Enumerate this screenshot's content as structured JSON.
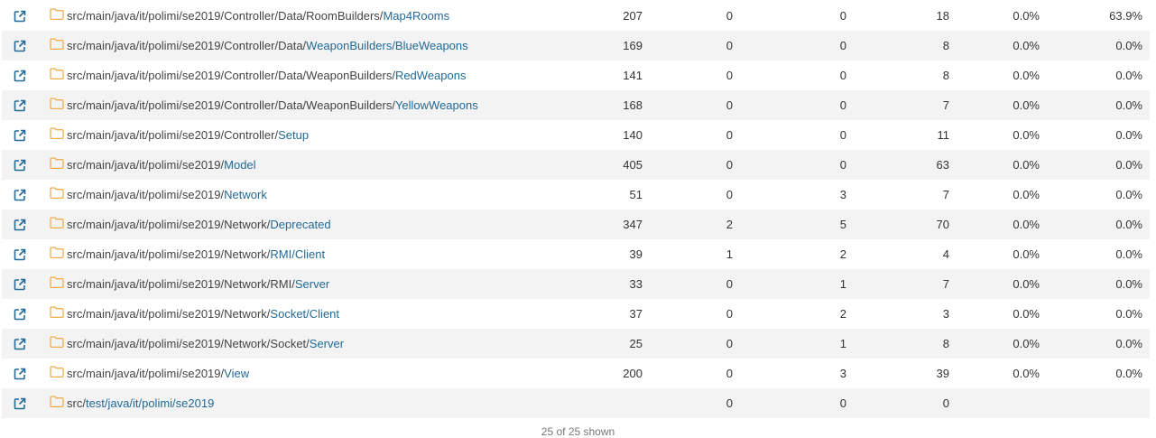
{
  "rows": [
    {
      "prefix": "src/main/java/it/polimi/se2019/Controller/Data/RoomBuilders/",
      "name": "Map4Rooms",
      "c1": "207",
      "c2": "0",
      "c3": "0",
      "c4": "18",
      "c5": "0.0%",
      "c6": "63.9%"
    },
    {
      "prefix": "src/main/java/it/polimi/se2019/Controller/Data/",
      "name": "WeaponBuilders/BlueWeapons",
      "c1": "169",
      "c2": "0",
      "c3": "0",
      "c4": "8",
      "c5": "0.0%",
      "c6": "0.0%"
    },
    {
      "prefix": "src/main/java/it/polimi/se2019/Controller/Data/WeaponBuilders/",
      "name": "RedWeapons",
      "c1": "141",
      "c2": "0",
      "c3": "0",
      "c4": "8",
      "c5": "0.0%",
      "c6": "0.0%"
    },
    {
      "prefix": "src/main/java/it/polimi/se2019/Controller/Data/WeaponBuilders/",
      "name": "YellowWeapons",
      "c1": "168",
      "c2": "0",
      "c3": "0",
      "c4": "7",
      "c5": "0.0%",
      "c6": "0.0%"
    },
    {
      "prefix": "src/main/java/it/polimi/se2019/Controller/",
      "name": "Setup",
      "c1": "140",
      "c2": "0",
      "c3": "0",
      "c4": "11",
      "c5": "0.0%",
      "c6": "0.0%"
    },
    {
      "prefix": "src/main/java/it/polimi/se2019/",
      "name": "Model",
      "c1": "405",
      "c2": "0",
      "c3": "0",
      "c4": "63",
      "c5": "0.0%",
      "c6": "0.0%"
    },
    {
      "prefix": "src/main/java/it/polimi/se2019/",
      "name": "Network",
      "c1": "51",
      "c2": "0",
      "c3": "3",
      "c4": "7",
      "c5": "0.0%",
      "c6": "0.0%"
    },
    {
      "prefix": "src/main/java/it/polimi/se2019/Network/",
      "name": "Deprecated",
      "c1": "347",
      "c2": "2",
      "c3": "5",
      "c4": "70",
      "c5": "0.0%",
      "c6": "0.0%"
    },
    {
      "prefix": "src/main/java/it/polimi/se2019/Network/",
      "name": "RMI/Client",
      "c1": "39",
      "c2": "1",
      "c3": "2",
      "c4": "4",
      "c5": "0.0%",
      "c6": "0.0%"
    },
    {
      "prefix": "src/main/java/it/polimi/se2019/Network/RMI/",
      "name": "Server",
      "c1": "33",
      "c2": "0",
      "c3": "1",
      "c4": "7",
      "c5": "0.0%",
      "c6": "0.0%"
    },
    {
      "prefix": "src/main/java/it/polimi/se2019/Network/",
      "name": "Socket/Client",
      "c1": "37",
      "c2": "0",
      "c3": "2",
      "c4": "3",
      "c5": "0.0%",
      "c6": "0.0%"
    },
    {
      "prefix": "src/main/java/it/polimi/se2019/Network/Socket/",
      "name": "Server",
      "c1": "25",
      "c2": "0",
      "c3": "1",
      "c4": "8",
      "c5": "0.0%",
      "c6": "0.0%"
    },
    {
      "prefix": "src/main/java/it/polimi/se2019/",
      "name": "View",
      "c1": "200",
      "c2": "0",
      "c3": "3",
      "c4": "39",
      "c5": "0.0%",
      "c6": "0.0%"
    },
    {
      "prefix": "src/",
      "name": "test/java/it/polimi/se2019",
      "c1": "",
      "c2": "0",
      "c3": "0",
      "c4": "0",
      "c5": "",
      "c6": ""
    }
  ],
  "footer": "25 of 25 shown",
  "icons": {
    "link": "external-link-icon",
    "folder": "folder-icon"
  },
  "colors": {
    "link": "#236a97",
    "folder": "#f0ad4e",
    "stripe": "#f3f3f3"
  }
}
